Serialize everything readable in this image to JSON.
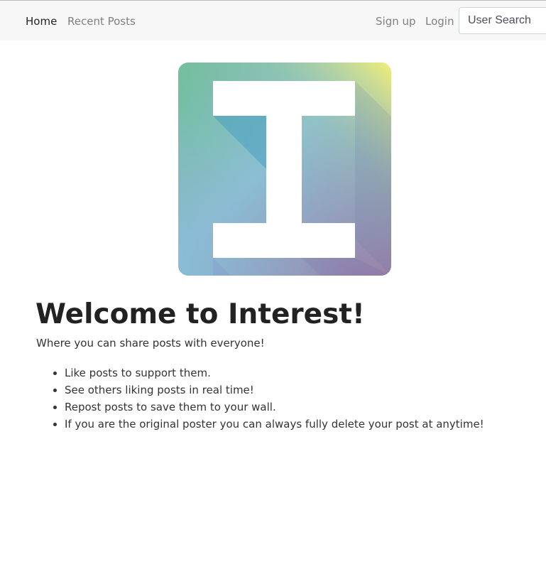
{
  "navbar": {
    "items": [
      {
        "label": "Home",
        "active": true
      },
      {
        "label": "Recent Posts",
        "active": false
      }
    ],
    "signup_label": "Sign up",
    "login_label": "Login",
    "search": {
      "placeholder": "User Search",
      "value": ""
    }
  },
  "logo": {
    "letter": "I",
    "colors": {
      "top_left": "#6fbf97",
      "top_right": "#f4ef76",
      "bottom_left": "#85c0d8",
      "bottom_right": "#9b7aa5",
      "letter": "#ffffff"
    }
  },
  "main": {
    "title": "Welcome to Interest!",
    "tagline": "Where you can share posts with everyone!",
    "features": [
      "Like posts to support them.",
      "See others liking posts in real time!",
      "Repost posts to save them to your wall.",
      "If you are the original poster you can always fully delete your post at anytime!"
    ]
  }
}
